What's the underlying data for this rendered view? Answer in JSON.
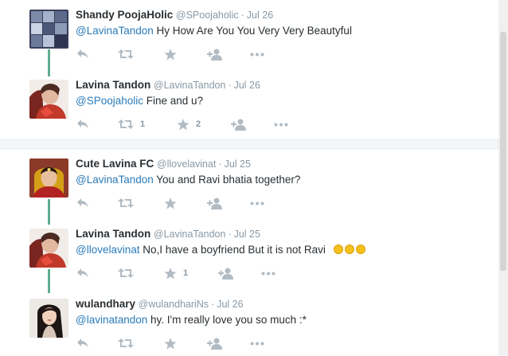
{
  "colors": {
    "link": "#2b7bb9",
    "thread_line": "#5ead8e",
    "icon": "#b1bbc3",
    "muted": "#8899a6"
  },
  "icons": [
    "reply-icon",
    "retweet-icon",
    "favorite-star-icon",
    "follow-icon",
    "more-icon"
  ],
  "conversations": [
    {
      "tweets": [
        {
          "name": "Shandy PoojaHolic",
          "handle": "@SPoojaholic",
          "sep": "·",
          "date": "Jul 26",
          "mention": "@LavinaTandon",
          "text": " Hy How Are You You Very Very Beautyful",
          "retweets": "",
          "favorites": ""
        },
        {
          "name": "Lavina Tandon",
          "handle": "@LavinaTandon",
          "sep": "·",
          "date": "Jul 26",
          "mention": "@SPoojaholic",
          "text": " Fine and u?",
          "retweets": "1",
          "favorites": "2"
        }
      ]
    },
    {
      "tweets": [
        {
          "name": "Cute Lavina FC",
          "handle": "@llovelavinat",
          "sep": "·",
          "date": "Jul 25",
          "mention": "@LavinaTandon",
          "text": " You and Ravi bhatia together?",
          "retweets": "",
          "favorites": ""
        },
        {
          "name": "Lavina Tandon",
          "handle": "@LavinaTandon",
          "sep": "·",
          "date": "Jul 25",
          "mention": "@llovelavinat",
          "text": " No,I have a boyfriend But it is not Ravi",
          "emoji_count": 3,
          "retweets": "",
          "favorites": "1"
        },
        {
          "name": "wulandhary",
          "handle": "@wulandhariNs",
          "sep": "·",
          "date": "Jul 26",
          "mention": "@lavinatandon",
          "text": " hy. I'm really love you so much :*",
          "retweets": "",
          "favorites": ""
        }
      ]
    }
  ]
}
